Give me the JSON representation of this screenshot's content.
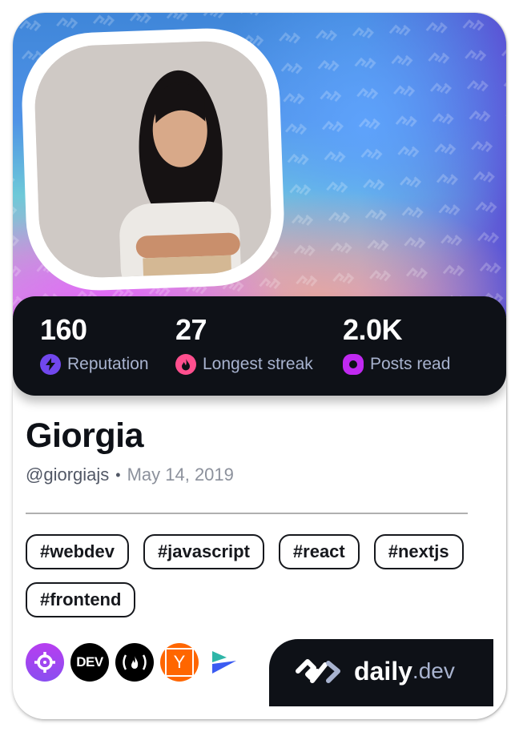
{
  "profile": {
    "name": "Giorgia",
    "username": "@giorgiajs",
    "separator": "•",
    "joined": "May 14, 2019",
    "avatar": "profile-photo"
  },
  "stats": [
    {
      "value": "160",
      "label": "Reputation",
      "icon": "lightning-icon",
      "color": "#7147ed"
    },
    {
      "value": "27",
      "label": "Longest streak",
      "icon": "flame-icon",
      "color": "#ff4f8e"
    },
    {
      "value": "2.0K",
      "label": "Posts read",
      "icon": "eye-ring-icon",
      "color": "#c029f0"
    }
  ],
  "tags": [
    "#webdev",
    "#javascript",
    "#react",
    "#nextjs",
    "#frontend"
  ],
  "sources": [
    {
      "name": "crosshair-source",
      "text": "",
      "bg": "#a743f2"
    },
    {
      "name": "dev-to-source",
      "text": "DEV",
      "bg": "#000000"
    },
    {
      "name": "freecodecamp-source",
      "text": "(🔥)",
      "bg": "#000000"
    },
    {
      "name": "hacker-news-source",
      "text": "Y",
      "bg": "#ff6600"
    },
    {
      "name": "arrow-source",
      "text": "",
      "bg": "transparent"
    }
  ],
  "brand": {
    "primary": "daily",
    "secondary": ".dev"
  },
  "colors": {
    "dark": "#0e1117",
    "label": "#a8b3cf"
  }
}
